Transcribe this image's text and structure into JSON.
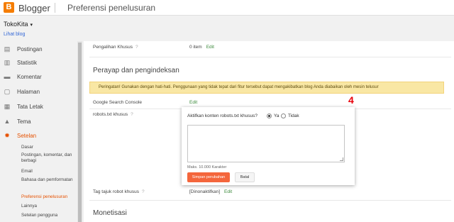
{
  "header": {
    "logo_letter": "B",
    "brand": "Blogger",
    "page_title": "Preferensi penelusuran"
  },
  "blog": {
    "name": "TokoKita",
    "caret": "▾",
    "view_link": "Lihat blog"
  },
  "sidebar": {
    "items": [
      {
        "label": "Postingan",
        "icon": "document-icon"
      },
      {
        "label": "Statistik",
        "icon": "stats-icon"
      },
      {
        "label": "Komentar",
        "icon": "comment-icon"
      },
      {
        "label": "Halaman",
        "icon": "page-icon"
      },
      {
        "label": "Tata Letak",
        "icon": "layout-icon"
      },
      {
        "label": "Tema",
        "icon": "theme-icon"
      },
      {
        "label": "Setelan",
        "icon": "gear-icon"
      }
    ],
    "sub_items": [
      "Dasar",
      "Postingan, komentar, dan berbagi",
      "Email",
      "Bahasa dan pemformatan",
      "Preferensi penelusuran",
      "Lainnya",
      "Setelan pengguna"
    ]
  },
  "main": {
    "redirect_label": "Pengalihan Khusus",
    "redirect_value": "0 item",
    "help": "?",
    "edit": "Edit",
    "crawler_section": "Perayap dan pengindeksan",
    "warning": "Peringatan! Gunakan dengan hati-hati. Penggunaan yang tidak tepat dari fitur tersebut dapat mengakibatkan blog Anda diabaikan oleh mesin telusur",
    "gsc_label": "Google Search Console",
    "robots_label": "robots.txt khusus",
    "robots_tags_label": "Tag tajuk robot khusus",
    "robots_tags_value": "[Dinonaktifkan]",
    "monetization_section": "Monetisasi"
  },
  "modal": {
    "question": "Aktifkan konten robots.txt khusus?",
    "option_yes": "Ya",
    "option_no": "Tidak",
    "textarea_value": "",
    "max_chars": "Maks. 10.000 Karakter",
    "save": "Simpan perubahan",
    "cancel": "Batal"
  },
  "annotation": {
    "marker": "4",
    "color": "#e8000a"
  },
  "colors": {
    "accent": "#f57d00",
    "active": "#e65100",
    "save_button": "#f4663c",
    "link": "#3c8a3c",
    "warning_bg": "#f9e7a4"
  }
}
